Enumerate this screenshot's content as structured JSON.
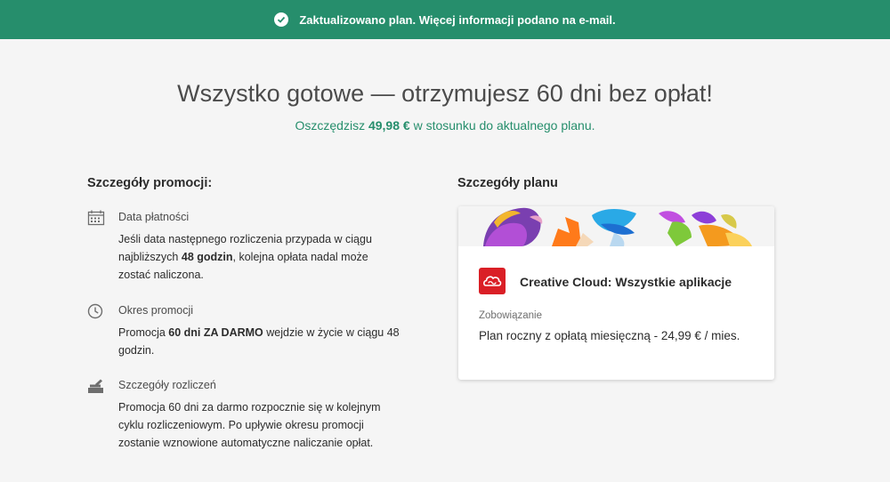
{
  "banner": {
    "text": "Zaktualizowano plan. Więcej informacji podano na e-mail.",
    "icon": "check-circle-icon",
    "color": "#268e6c"
  },
  "headline": "Wszystko gotowe — otrzymujesz 60 dni bez opłat!",
  "savings": {
    "prefix": "Oszczędzisz ",
    "amount": "49,98 €",
    "suffix": " w stosunku do aktualnego planu."
  },
  "promo": {
    "title": "Szczegóły promocji:",
    "items": [
      {
        "icon": "calendar-icon",
        "title": "Data płatności",
        "body_1": "Jeśli data następnego rozliczenia przypada w ciągu najbliższych ",
        "body_bold": "48 godzin",
        "body_2": ", kolejna opłata nadal może zostać naliczona."
      },
      {
        "icon": "clock-icon",
        "title": "Okres promocji",
        "body_1": "Promocja ",
        "body_bold": "60 dni ZA DARMO",
        "body_2": " wejdzie w życie w ciągu 48 godzin."
      },
      {
        "icon": "billing-icon",
        "title": "Szczegóły rozliczeń",
        "body_1": "Promocja 60 dni za darmo rozpocznie się w kolejnym cyklu rozliczeniowym. Po upływie okresu promocji zostanie wznowione automatyczne naliczanie opłat."
      }
    ]
  },
  "plan": {
    "title": "Szczegóły planu",
    "product": "Creative Cloud: Wszystkie aplikacje",
    "commitment_label": "Zobowiązanie",
    "commitment_value": "Plan roczny z opłatą miesięczną - 24,99 € / mies.",
    "logo_icon": "creative-cloud-logo-icon"
  }
}
